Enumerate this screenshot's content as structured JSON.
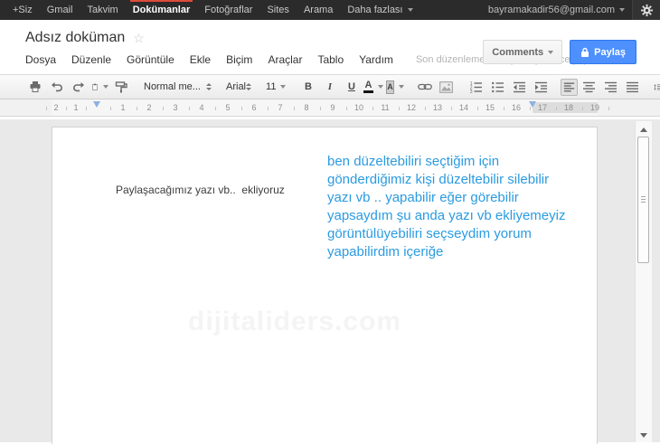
{
  "colors": {
    "accent_red": "#dd4b39",
    "share_blue": "#4d90fe",
    "blue_text": "#2b9be0",
    "topbar_bg": "#2b2b2b"
  },
  "topbar": {
    "items": [
      "+Siz",
      "Gmail",
      "Takvim",
      "Dokümanlar",
      "Fotoğraflar",
      "Sites",
      "Arama",
      "Daha fazlası"
    ],
    "active_item": "Dokümanlar",
    "dropdown_item": "Daha fazlası",
    "account_email": "bayramakadir56@gmail.com"
  },
  "header": {
    "doc_title": "Adsız doküman",
    "comments_label": "Comments",
    "share_label": "Paylaş",
    "status_text": "Son düzenleme birkaç saniye önce yapıldı"
  },
  "menubar": {
    "items": [
      "Dosya",
      "Düzenle",
      "Görüntüle",
      "Ekle",
      "Biçim",
      "Araçlar",
      "Tablo",
      "Yardım"
    ]
  },
  "toolbar": {
    "style_value": "Normal me...",
    "font_value": "Arial",
    "size_value": "11",
    "bold_label": "B",
    "italic_label": "I",
    "underline_label": "U",
    "text_color_label": "A",
    "highlight_label": "A"
  },
  "ruler": {
    "left_numbers": [
      "2",
      "1"
    ],
    "numbers": [
      "1",
      "2",
      "3",
      "4",
      "5",
      "6",
      "7",
      "8",
      "9",
      "10",
      "11",
      "12",
      "13",
      "14",
      "15",
      "16",
      "17",
      "18",
      "19"
    ]
  },
  "icons": {
    "star": "☆"
  },
  "document": {
    "paragraph_text": "Paylaşacağımız yazı vb..  ekliyoruz",
    "blue_lines": [
      "ben düzeltebiliri seçtiğim için",
      "gönderdiğimiz kişi düzeltebilir silebilir",
      "yazı vb ..  yapabilir eğer görebilir",
      "yapsaydım şu anda yazı vb ekliyemeyiz",
      "görüntülüyebiliri seçseydim yorum",
      "yapabilirdim içeriğe"
    ],
    "watermark": "dijitaliders.com"
  }
}
